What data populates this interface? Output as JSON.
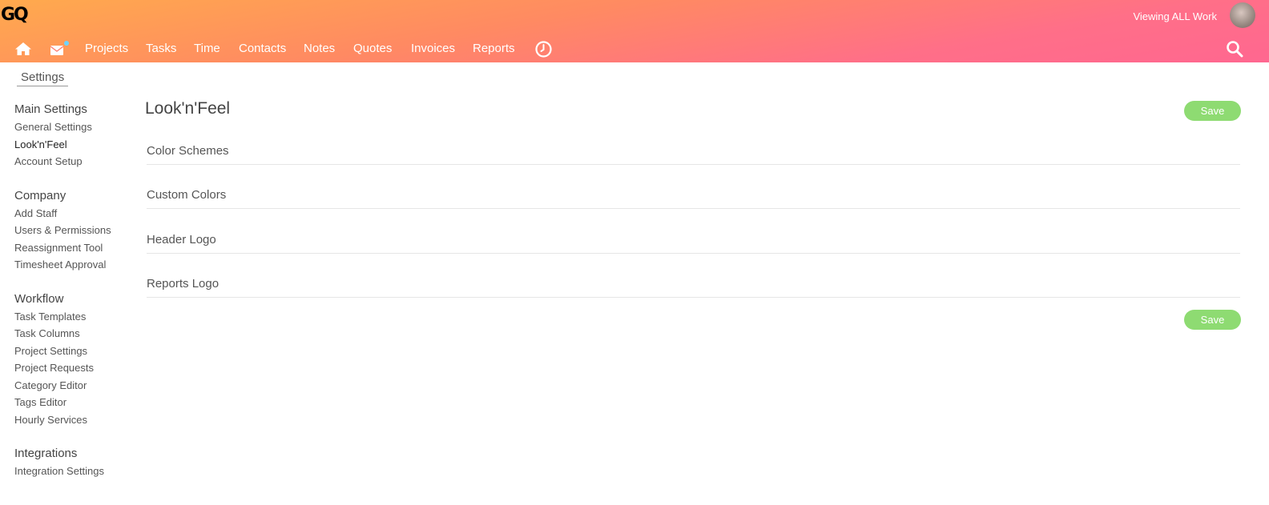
{
  "brand": {
    "logo_text": "GQ"
  },
  "header": {
    "viewing_text": "Viewing ALL Work",
    "nav": [
      {
        "label": "Projects"
      },
      {
        "label": "Tasks"
      },
      {
        "label": "Time"
      },
      {
        "label": "Contacts"
      },
      {
        "label": "Notes"
      },
      {
        "label": "Quotes"
      },
      {
        "label": "Invoices"
      },
      {
        "label": "Reports"
      }
    ],
    "icons": [
      "home-icon",
      "mail-icon",
      "clock-icon",
      "search-icon"
    ],
    "notification_dot_color": "#6fd3ff"
  },
  "breadcrumb": {
    "label": "Settings"
  },
  "sidebar": {
    "groups": [
      {
        "heading": "Main Settings",
        "items": [
          "General Settings",
          "Look'n'Feel",
          "Account Setup"
        ]
      },
      {
        "heading": "Company",
        "items": [
          "Add Staff",
          "Users & Permissions",
          "Reassignment Tool",
          "Timesheet Approval"
        ]
      },
      {
        "heading": "Workflow",
        "items": [
          "Task Templates",
          "Task Columns",
          "Project Settings",
          "Project Requests",
          "Category Editor",
          "Tags Editor",
          "Hourly Services"
        ]
      },
      {
        "heading": "Integrations",
        "items": [
          "Integration Settings"
        ]
      }
    ],
    "active_item": "Look'n'Feel"
  },
  "main": {
    "title": "Look'n'Feel",
    "save_label": "Save",
    "sections": [
      "Color Schemes",
      "Custom Colors",
      "Header Logo",
      "Reports Logo"
    ]
  },
  "colors": {
    "header_gradient_start": "#ffaa4d",
    "header_gradient_end": "#ff6790",
    "save_button": "#8edb72"
  }
}
